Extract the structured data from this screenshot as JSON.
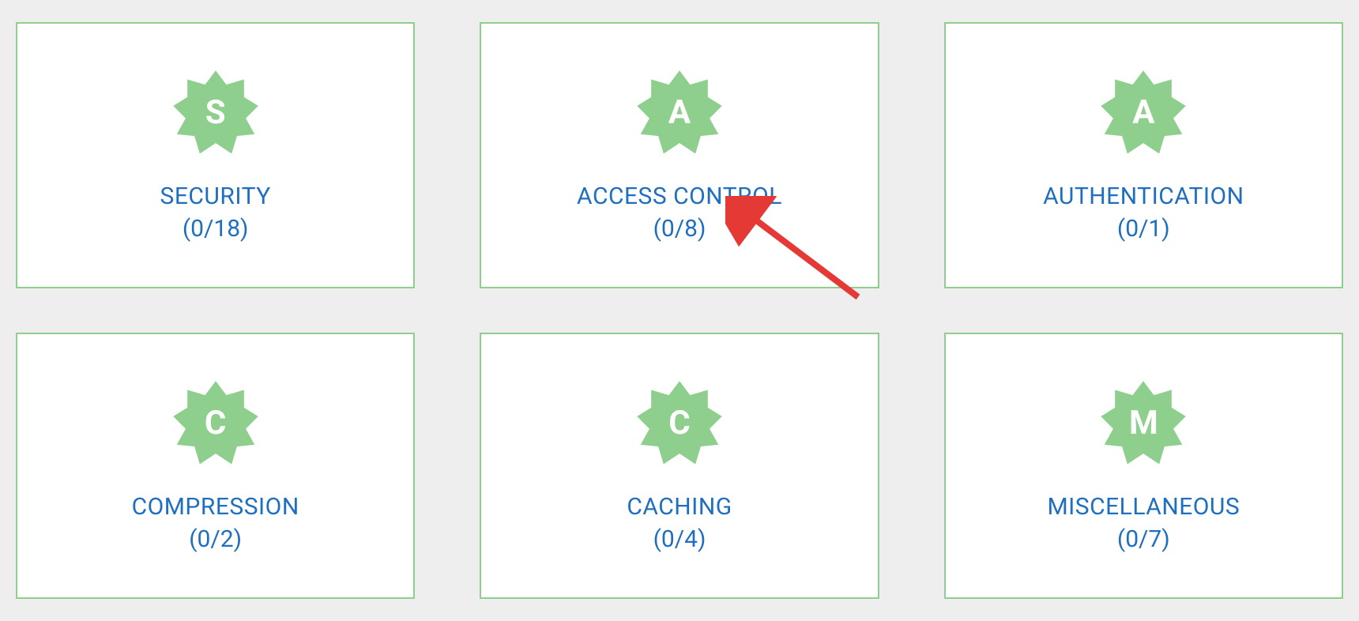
{
  "colors": {
    "badge_fill": "#8ecf8e",
    "card_border": "#8ecf8e",
    "text_link": "#1f6fc0",
    "arrow": "#e53935"
  },
  "cards": [
    {
      "letter": "S",
      "title": "SECURITY",
      "count": "(0/18)",
      "name": "card-security"
    },
    {
      "letter": "A",
      "title": "ACCESS CONTROL",
      "count": "(0/8)",
      "name": "card-access-control"
    },
    {
      "letter": "A",
      "title": "AUTHENTICATION",
      "count": "(0/1)",
      "name": "card-authentication"
    },
    {
      "letter": "C",
      "title": "COMPRESSION",
      "count": "(0/2)",
      "name": "card-compression"
    },
    {
      "letter": "C",
      "title": "CACHING",
      "count": "(0/4)",
      "name": "card-caching"
    },
    {
      "letter": "M",
      "title": "MISCELLANEOUS",
      "count": "(0/7)",
      "name": "card-miscellaneous"
    }
  ]
}
